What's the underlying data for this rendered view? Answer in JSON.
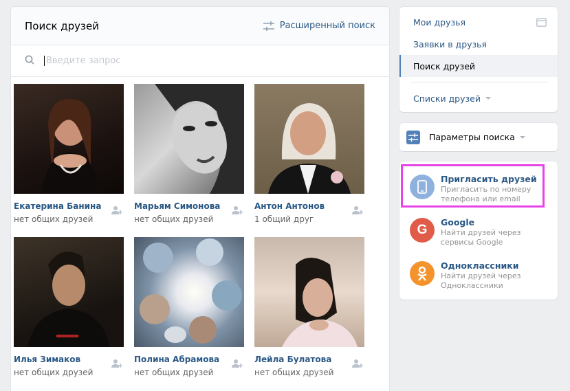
{
  "main": {
    "title": "Поиск друзей",
    "advanced_search_label": "Расширенный поиск",
    "search_placeholder": "Введите запрос"
  },
  "people": [
    {
      "name": "Екатерина Банина",
      "sub": "нет общих друзей"
    },
    {
      "name": "Марьям Симонова",
      "sub": "нет общих друзей"
    },
    {
      "name": "Антон Антонов",
      "sub": "1 общий друг"
    },
    {
      "name": "Илья Зимаков",
      "sub": "нет общих друзей"
    },
    {
      "name": "Полина Абрамова",
      "sub": "нет общих друзей"
    },
    {
      "name": "Лейла Булатова",
      "sub": "нет общих друзей"
    }
  ],
  "nav": {
    "items": [
      {
        "label": "Мои друзья"
      },
      {
        "label": "Заявки в друзья"
      },
      {
        "label": "Поиск друзей"
      },
      {
        "label": "Списки друзей"
      }
    ]
  },
  "params": {
    "label": "Параметры поиска"
  },
  "invite": {
    "items": [
      {
        "title": "Пригласить друзей",
        "desc": "Пригласить по номеру телефона или email",
        "icon": "phone-icon",
        "color": "#8fb1de"
      },
      {
        "title": "Google",
        "desc": "Найти друзей через сервисы Google",
        "icon": "google-icon",
        "color": "#e05c48"
      },
      {
        "title": "Одноклассники",
        "desc": "Найти друзей через Одноклассники",
        "icon": "ok-icon",
        "color": "#f4932c"
      }
    ]
  },
  "colors": {
    "link": "#2a5885",
    "accent": "#5181b8",
    "highlight": "#e843e8"
  }
}
